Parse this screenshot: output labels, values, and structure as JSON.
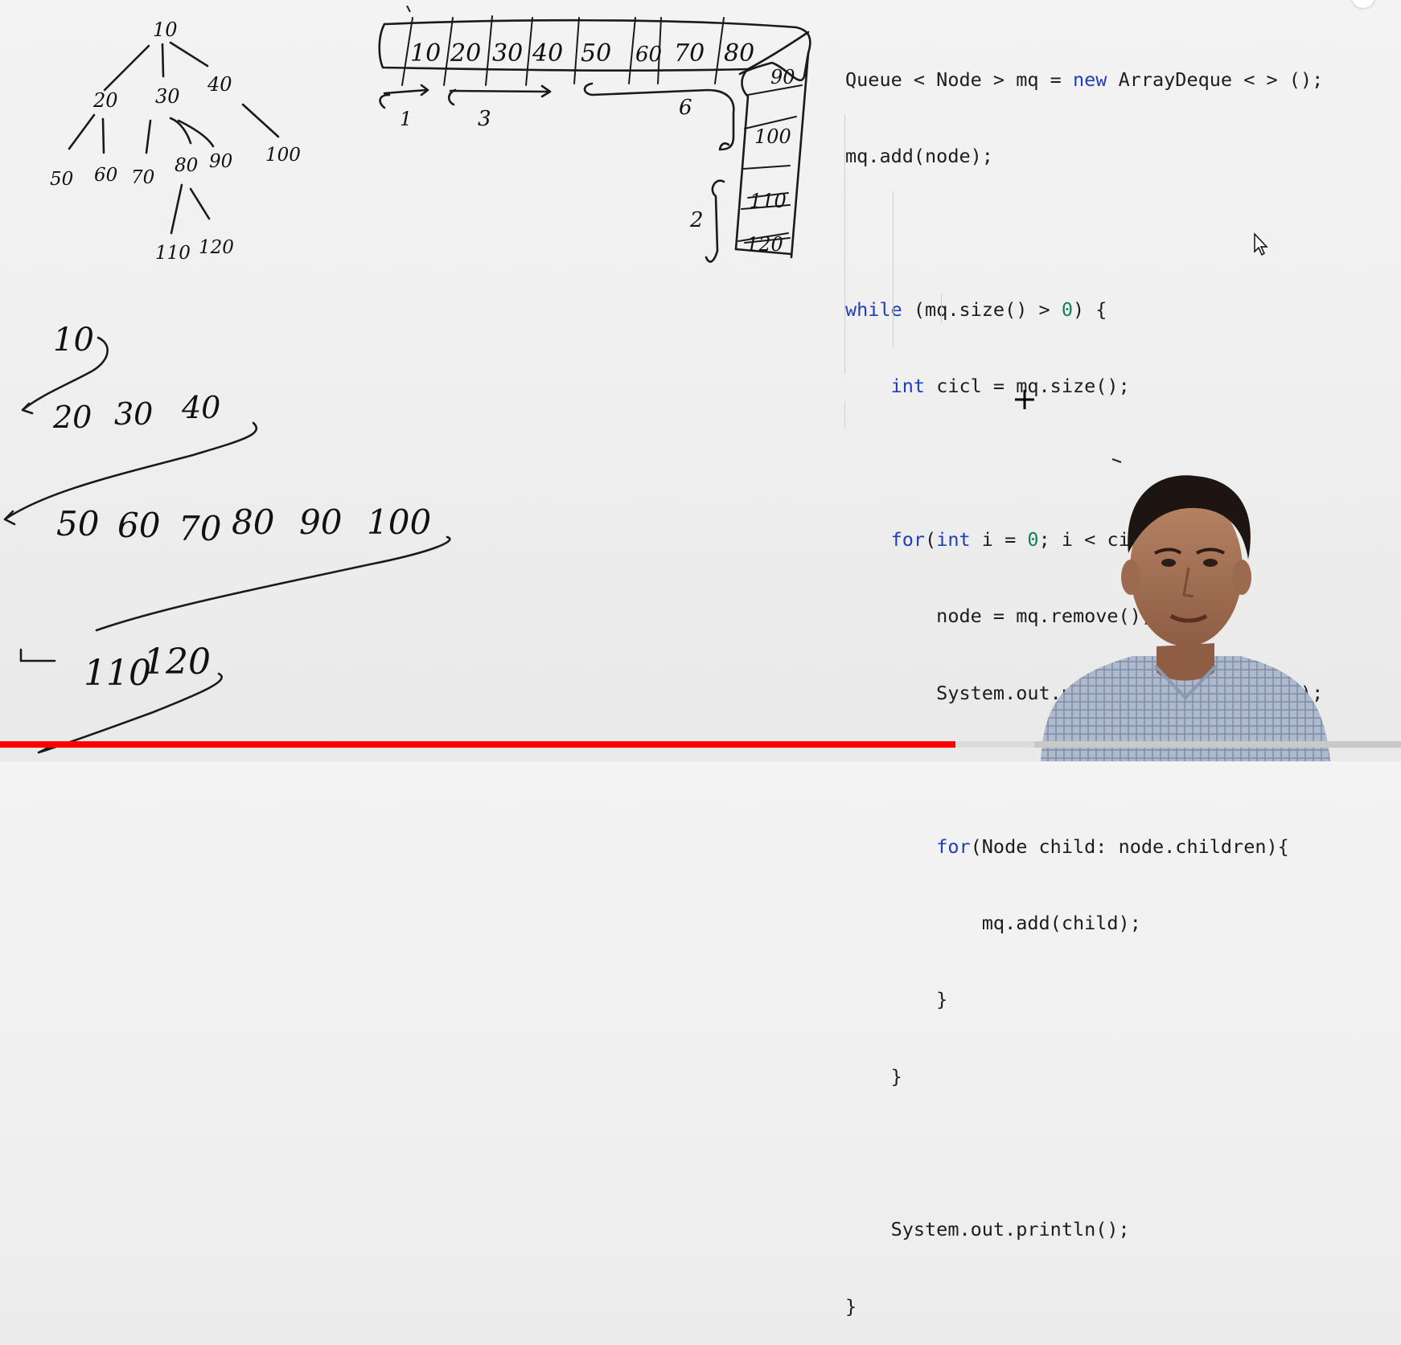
{
  "whiteboard": {
    "tree": {
      "root": "10",
      "level1": [
        "20",
        "30",
        "40"
      ],
      "level2": [
        "50",
        "60",
        "70",
        "80",
        "90",
        "100"
      ],
      "level3": [
        "110",
        "120"
      ]
    },
    "queue_cells": [
      "10",
      "20",
      "30",
      "40",
      "50",
      "60",
      "70",
      "80"
    ],
    "queue_vertical_cells": [
      "90",
      "100",
      "110",
      "120"
    ],
    "counts": [
      "1",
      "3",
      "6",
      "2"
    ],
    "levels": [
      {
        "items": [
          "10"
        ]
      },
      {
        "items": [
          "20",
          "30",
          "40"
        ]
      },
      {
        "items": [
          "50",
          "60",
          "70",
          "80",
          "90",
          "100"
        ]
      },
      {
        "items": [
          "110",
          "120"
        ]
      }
    ]
  },
  "code": {
    "lines": [
      "Queue < Node > mq = new ArrayDeque < > ();",
      "mq.add(node);",
      "",
      "while (mq.size() > 0) {",
      "    int cicl = mq.size();",
      "",
      "    for(int i = 0; i < cicl; i++){",
      "        node = mq.remove();",
      "        System.out.print(node.data + \" \");",
      "",
      "        for(Node child: node.children){",
      "            mq.add(child);",
      "        }",
      "    }",
      "",
      "    System.out.println();",
      "}"
    ]
  },
  "progress": {
    "played": 0.682,
    "buffered": 0.738
  },
  "colors": {
    "keyword": "#1f3fb8",
    "number": "#098658",
    "progress": "#ff0000",
    "ink": "#1a1a1a"
  },
  "icons": {
    "cursor": "mouse-pointer-icon",
    "crosshair": "crosshair-icon"
  }
}
